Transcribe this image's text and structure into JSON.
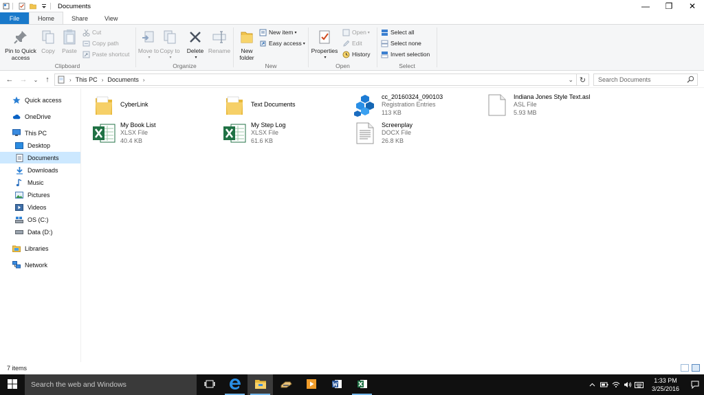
{
  "window": {
    "title": "Documents",
    "minimize_glyph": "—",
    "maximize_glyph": "❐",
    "close_glyph": "✕"
  },
  "ribbon_tabs": [
    {
      "label": "File",
      "type": "file"
    },
    {
      "label": "Home",
      "type": "active"
    },
    {
      "label": "Share",
      "type": "normal"
    },
    {
      "label": "View",
      "type": "normal"
    }
  ],
  "ribbon": {
    "clipboard": {
      "label": "Clipboard",
      "pin": "Pin to Quick access",
      "copy": "Copy",
      "paste": "Paste",
      "cut": "Cut",
      "copy_path": "Copy path",
      "paste_shortcut": "Paste shortcut"
    },
    "organize": {
      "label": "Organize",
      "move_to": "Move to",
      "copy_to": "Copy to",
      "delete": "Delete",
      "rename": "Rename"
    },
    "new": {
      "label": "New",
      "new_folder": "New folder",
      "new_item": "New item",
      "easy_access": "Easy access"
    },
    "open": {
      "label": "Open",
      "properties": "Properties",
      "open": "Open",
      "edit": "Edit",
      "history": "History"
    },
    "select": {
      "label": "Select",
      "select_all": "Select all",
      "select_none": "Select none",
      "invert_selection": "Invert selection"
    }
  },
  "address": {
    "crumbs": [
      "This PC",
      "Documents"
    ],
    "search_placeholder": "Search Documents"
  },
  "nav_pane": [
    {
      "label": "Quick access",
      "icon": "star-icon"
    },
    {
      "label": "OneDrive",
      "icon": "cloud-icon"
    },
    {
      "label": "This PC",
      "icon": "computer-icon"
    },
    {
      "label": "Desktop",
      "icon": "desktop-folder-icon"
    },
    {
      "label": "Documents",
      "icon": "documents-folder-icon",
      "selected": true
    },
    {
      "label": "Downloads",
      "icon": "download-arrow-icon"
    },
    {
      "label": "Music",
      "icon": "music-note-icon"
    },
    {
      "label": "Pictures",
      "icon": "pictures-folder-icon"
    },
    {
      "label": "Videos",
      "icon": "videos-folder-icon"
    },
    {
      "label": "OS (C:)",
      "icon": "os-drive-icon"
    },
    {
      "label": "Data (D:)",
      "icon": "drive-icon"
    },
    {
      "label": "Libraries",
      "icon": "libraries-icon"
    },
    {
      "label": "Network",
      "icon": "network-icon"
    }
  ],
  "files": [
    {
      "name": "CyberLink",
      "type": "",
      "size": "",
      "icon": "folder-icon"
    },
    {
      "name": "Text Documents",
      "type": "",
      "size": "",
      "icon": "folder-icon"
    },
    {
      "name": "cc_20160324_090103",
      "type": "Registration Entries",
      "size": "113 KB",
      "icon": "registry-icon"
    },
    {
      "name": "Indiana Jones Style Text.asl",
      "type": "ASL File",
      "size": "5.93 MB",
      "icon": "blank-file-icon"
    },
    {
      "name": "My Book List",
      "type": "XLSX File",
      "size": "40.4 KB",
      "icon": "excel-file-icon"
    },
    {
      "name": "My Step Log",
      "type": "XLSX File",
      "size": "61.6 KB",
      "icon": "excel-file-icon"
    },
    {
      "name": "Screenplay",
      "type": "DOCX File",
      "size": "26.8 KB",
      "icon": "text-file-icon"
    }
  ],
  "status": {
    "item_count": "7 items"
  },
  "taskbar": {
    "search_placeholder": "Search the web and Windows",
    "time": "1:33 PM",
    "date": "3/25/2016"
  },
  "colors": {
    "accent": "#1979ca",
    "selected": "#cce8ff",
    "taskbar": "#101010",
    "folder": "#f1c44e",
    "excel": "#207245"
  }
}
